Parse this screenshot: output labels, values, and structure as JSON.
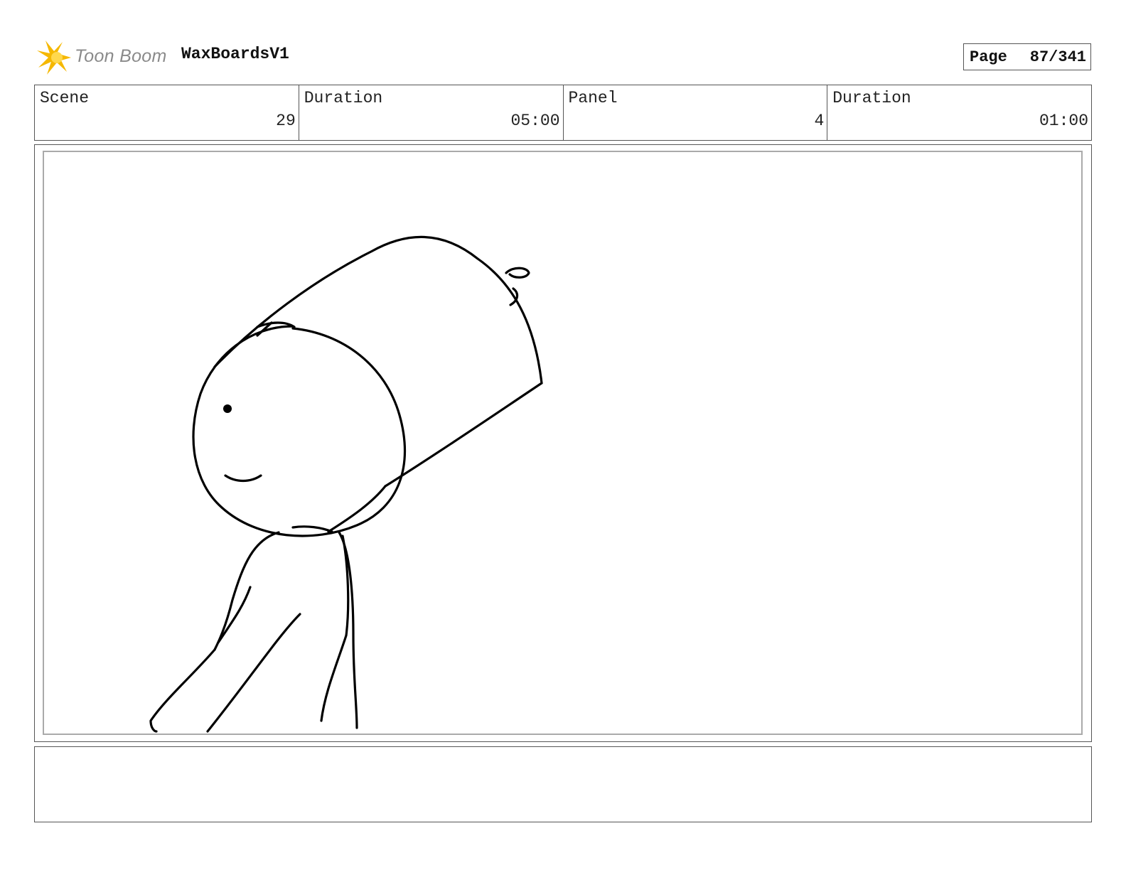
{
  "header": {
    "logo_text": "Toon Boom",
    "project_title": "WaxBoardsV1",
    "page_label": "Page",
    "page_number": "87/341"
  },
  "info": {
    "scene_label": "Scene",
    "scene_value": "29",
    "scene_duration_label": "Duration",
    "scene_duration_value": "05:00",
    "panel_label": "Panel",
    "panel_value": "4",
    "panel_duration_label": "Duration",
    "panel_duration_value": "01:00"
  },
  "notes": {
    "text": ""
  },
  "colors": {
    "logo_star": "#f5b800",
    "logo_text": "#8a8a8a",
    "border": "#555555"
  }
}
